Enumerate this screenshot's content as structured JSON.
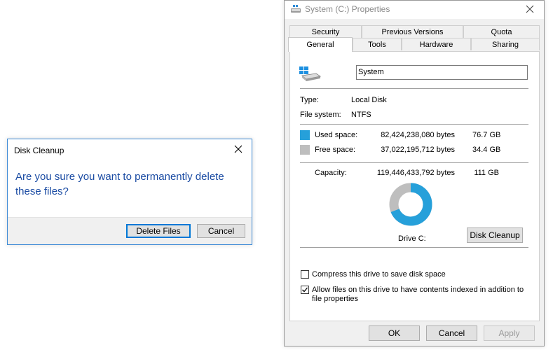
{
  "cleanup_dialog": {
    "title": "Disk Cleanup",
    "message": "Are you sure you want to permanently delete these files?",
    "delete_label": "Delete Files",
    "cancel_label": "Cancel"
  },
  "properties": {
    "title": "System (C:) Properties",
    "tabs_top": [
      "Security",
      "Previous Versions",
      "Quota"
    ],
    "tabs_bottom": [
      "General",
      "Tools",
      "Hardware",
      "Sharing"
    ],
    "active_tab": "General",
    "drive_name": "System",
    "type_label": "Type:",
    "type_value": "Local Disk",
    "fs_label": "File system:",
    "fs_value": "NTFS",
    "used": {
      "label": "Used space:",
      "bytes": "82,424,238,080 bytes",
      "size": "76.7 GB",
      "color": "#26a0da"
    },
    "free": {
      "label": "Free space:",
      "bytes": "37,022,195,712 bytes",
      "size": "34.4 GB",
      "color": "#bebebe"
    },
    "capacity": {
      "label": "Capacity:",
      "bytes": "119,446,433,792 bytes",
      "size": "111 GB"
    },
    "used_fraction": 0.69,
    "drive_caption": "Drive C:",
    "cleanup_button": "Disk Cleanup",
    "compress_label": "Compress this drive to save disk space",
    "compress_checked": false,
    "index_label_line1": "Allow files on this drive to have contents indexed in addition to",
    "index_label_line2": "file properties",
    "index_checked": true,
    "ok_label": "OK",
    "cancel_label": "Cancel",
    "apply_label": "Apply"
  }
}
